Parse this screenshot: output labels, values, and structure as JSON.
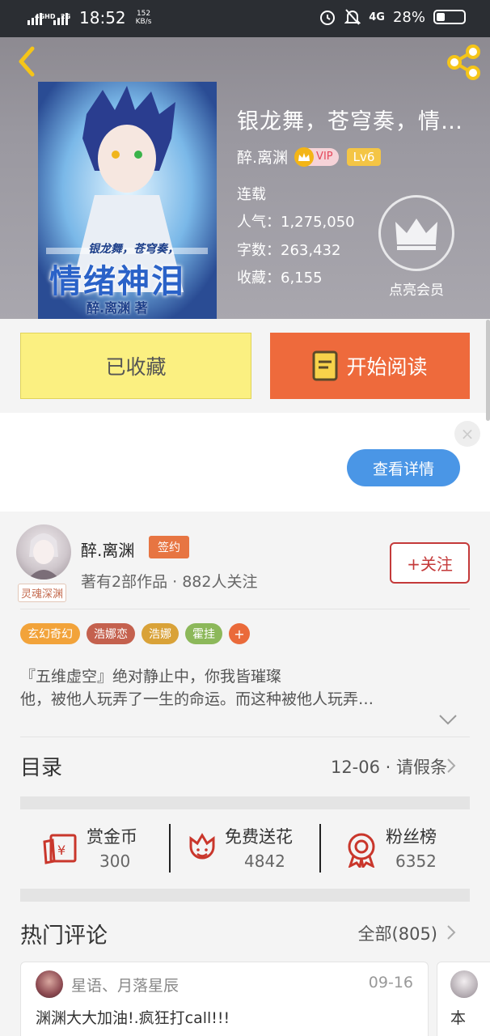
{
  "status_bar": {
    "time": "18:52",
    "net_speed_value": "152",
    "net_speed_unit": "KB/s",
    "signal1": "4GHD",
    "signal2": "2G",
    "network": "4G",
    "battery": "28%"
  },
  "book": {
    "title": "银龙舞，苍穹奏，情…",
    "author": "醉.离渊",
    "vip_label": "VIP",
    "level": "Lv6",
    "status": "连载",
    "popularity_label": "人气：",
    "popularity": "1,275,050",
    "words_label": "字数：",
    "words": "263,432",
    "favorites_label": "收藏：",
    "favorites": "6,155",
    "member_label": "点亮会员",
    "cover_title_small": "银龙舞，苍穹奏，",
    "cover_title_big": "情绪神泪",
    "cover_author": "醉.离渊 著"
  },
  "actions": {
    "favorited_label": "已收藏",
    "read_label": "开始阅读"
  },
  "ad": {
    "detail_label": "查看详情",
    "close_label": "×"
  },
  "author": {
    "avatar_tag": "灵魂深渊",
    "name": "醉.离渊",
    "sign_badge": "签约",
    "stats": "著有2部作品 · 882人关注",
    "follow_label": "+关注",
    "tags": [
      {
        "label": "玄幻奇幻",
        "color": "#f2a33a"
      },
      {
        "label": "浩娜恋",
        "color": "#c4614e"
      },
      {
        "label": "浩娜",
        "color": "#d9a238"
      },
      {
        "label": "霍挂",
        "color": "#8cb85a"
      }
    ],
    "more_tag": "+"
  },
  "intro": {
    "line1": "『五维虚空』绝对静止中，你我皆璀璨",
    "line2": "他，被他人玩弄了一生的命运。而这种被他人玩弄…"
  },
  "toc": {
    "title": "目录",
    "latest": "12-06 · 请假条"
  },
  "stats": [
    {
      "label": "赏金币",
      "value": "300",
      "icon": "red-envelope-icon"
    },
    {
      "label": "免费送花",
      "value": "4842",
      "icon": "flower-icon"
    },
    {
      "label": "粉丝榜",
      "value": "6352",
      "icon": "medal-icon"
    }
  ],
  "comments": {
    "title": "热门评论",
    "all_label": "全部(805)",
    "items": [
      {
        "user": "星语、月落星辰",
        "date": "09-16",
        "text": "渊渊大大加油!.疯狂打call!!!"
      },
      {
        "user": "",
        "date": "",
        "text": "本"
      }
    ]
  },
  "colors": {
    "accent_orange": "#ee6a3c",
    "favorite_yellow": "#fbf081",
    "detail_blue": "#4a96e6",
    "follow_red": "#c43a3a"
  }
}
